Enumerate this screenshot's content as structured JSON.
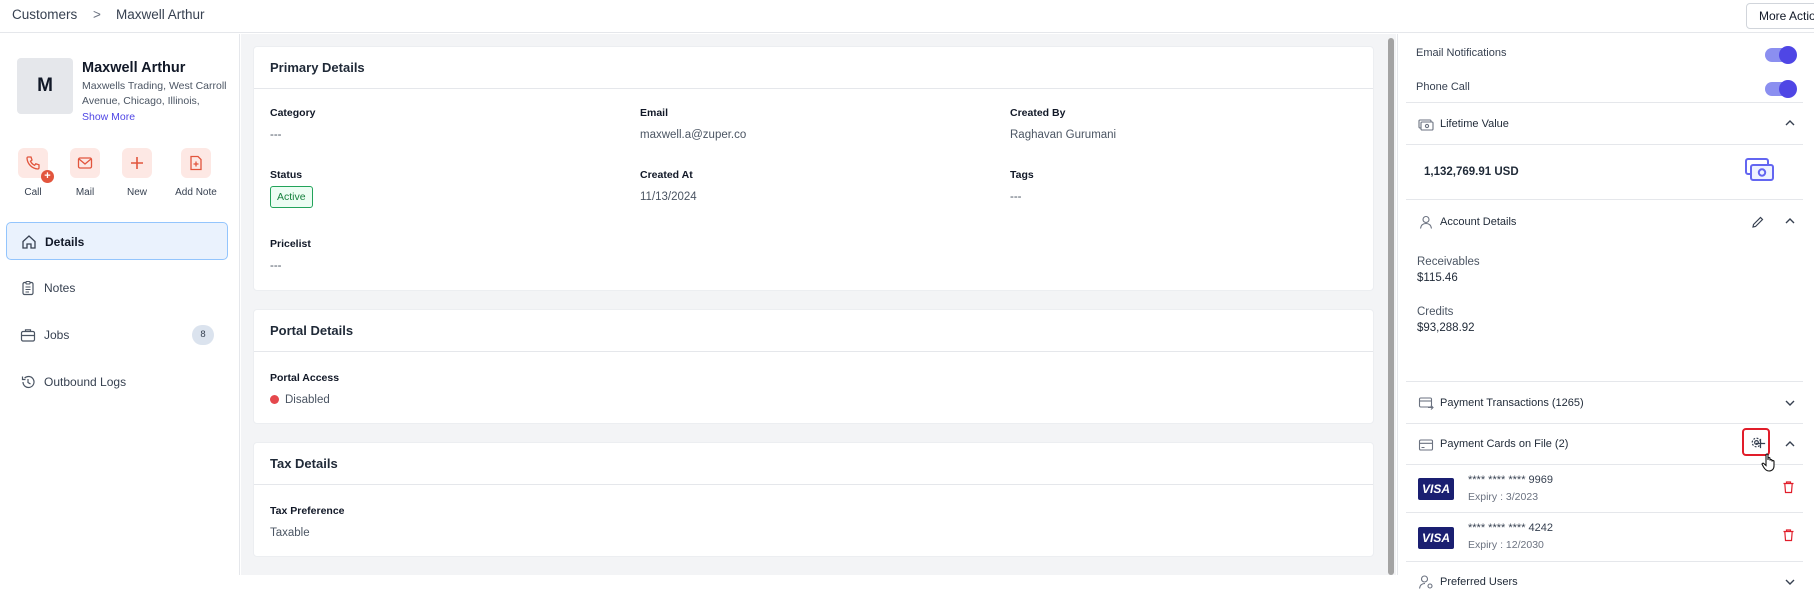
{
  "breadcrumb": {
    "root": "Customers",
    "separator": ">",
    "current": "Maxwell Arthur"
  },
  "header": {
    "more_actions": "More Actions"
  },
  "customer": {
    "initial": "M",
    "name": "Maxwell Arthur",
    "address": "Maxwells Trading, West Carroll Avenue, Chicago, Illinois, United...",
    "show_more": "Show More"
  },
  "actions": [
    {
      "label": "Call",
      "icon": "phone-add-icon"
    },
    {
      "label": "Mail",
      "icon": "mail-icon"
    },
    {
      "label": "New",
      "icon": "plus-icon"
    },
    {
      "label": "Add Note",
      "icon": "note-add-icon"
    }
  ],
  "nav": [
    {
      "label": "Details",
      "icon": "home-icon",
      "active": true
    },
    {
      "label": "Notes",
      "icon": "clipboard-icon"
    },
    {
      "label": "Jobs",
      "icon": "briefcase-icon",
      "badge": "8"
    },
    {
      "label": "Outbound Logs",
      "icon": "history-icon"
    }
  ],
  "primary": {
    "title": "Primary Details",
    "category_label": "Category",
    "category_value": "---",
    "email_label": "Email",
    "email_value": "maxwell.a@zuper.co",
    "created_by_label": "Created By",
    "created_by_value": "Raghavan Gurumani",
    "status_label": "Status",
    "status_value": "Active",
    "created_at_label": "Created At",
    "created_at_value": "11/13/2024",
    "tags_label": "Tags",
    "tags_value": "---",
    "pricelist_label": "Pricelist",
    "pricelist_value": "---"
  },
  "portal": {
    "title": "Portal Details",
    "access_label": "Portal Access",
    "access_value": "Disabled"
  },
  "tax": {
    "title": "Tax Details",
    "pref_label": "Tax Preference",
    "pref_value": "Taxable"
  },
  "right": {
    "email_notifications": "Email Notifications",
    "phone_call": "Phone Call",
    "lifetime_title": "Lifetime Value",
    "lifetime_value": "1,132,769.91 USD",
    "account_title": "Account Details",
    "receivables_label": "Receivables",
    "receivables_value": "$115.46",
    "credits_label": "Credits",
    "credits_value": "$93,288.92",
    "transactions_title": "Payment Transactions (1265)",
    "cards_title": "Payment Cards on File (2)",
    "cards": [
      {
        "brand": "VISA",
        "number": "**** **** **** 9969",
        "expiry": "Expiry : 3/2023"
      },
      {
        "brand": "VISA",
        "number": "**** **** **** 4242",
        "expiry": "Expiry : 12/2030"
      }
    ],
    "preferred_title": "Preferred Users"
  },
  "colors": {
    "accent": "#4f46e5",
    "action_bg": "#fde8e4",
    "action_icon": "#e2553d",
    "active_nav_bg": "#eaf2fd",
    "danger": "#e11d2a",
    "visa": "#1a1f71"
  }
}
